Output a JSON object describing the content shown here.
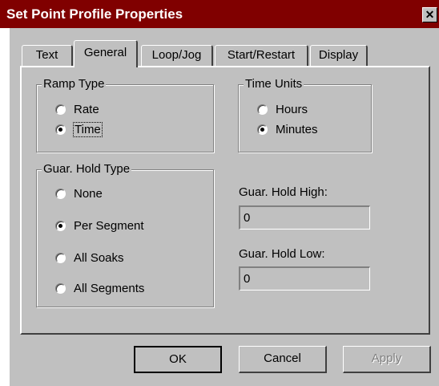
{
  "window": {
    "title": "Set Point Profile Properties",
    "close_glyph": "✕"
  },
  "tabs": [
    {
      "label": "Text"
    },
    {
      "label": "General",
      "active": true
    },
    {
      "label": "Loop/Jog"
    },
    {
      "label": "Start/Restart"
    },
    {
      "label": "Display"
    }
  ],
  "ramp_type": {
    "label": "Ramp Type",
    "options": [
      {
        "label": "Rate",
        "selected": false
      },
      {
        "label": "Time",
        "selected": true
      }
    ]
  },
  "time_units": {
    "label": "Time Units",
    "options": [
      {
        "label": "Hours",
        "selected": false
      },
      {
        "label": "Minutes",
        "selected": true
      }
    ]
  },
  "guar_hold_type": {
    "label": "Guar. Hold Type",
    "options": [
      {
        "label": "None",
        "selected": false
      },
      {
        "label": "Per Segment",
        "selected": true
      },
      {
        "label": "All Soaks",
        "selected": false
      },
      {
        "label": "All Segments",
        "selected": false
      }
    ]
  },
  "guar_hold_high": {
    "label": "Guar. Hold High:",
    "value": "0"
  },
  "guar_hold_low": {
    "label": "Guar. Hold Low:",
    "value": "0"
  },
  "buttons": {
    "ok": "OK",
    "cancel": "Cancel",
    "apply": "Apply"
  }
}
